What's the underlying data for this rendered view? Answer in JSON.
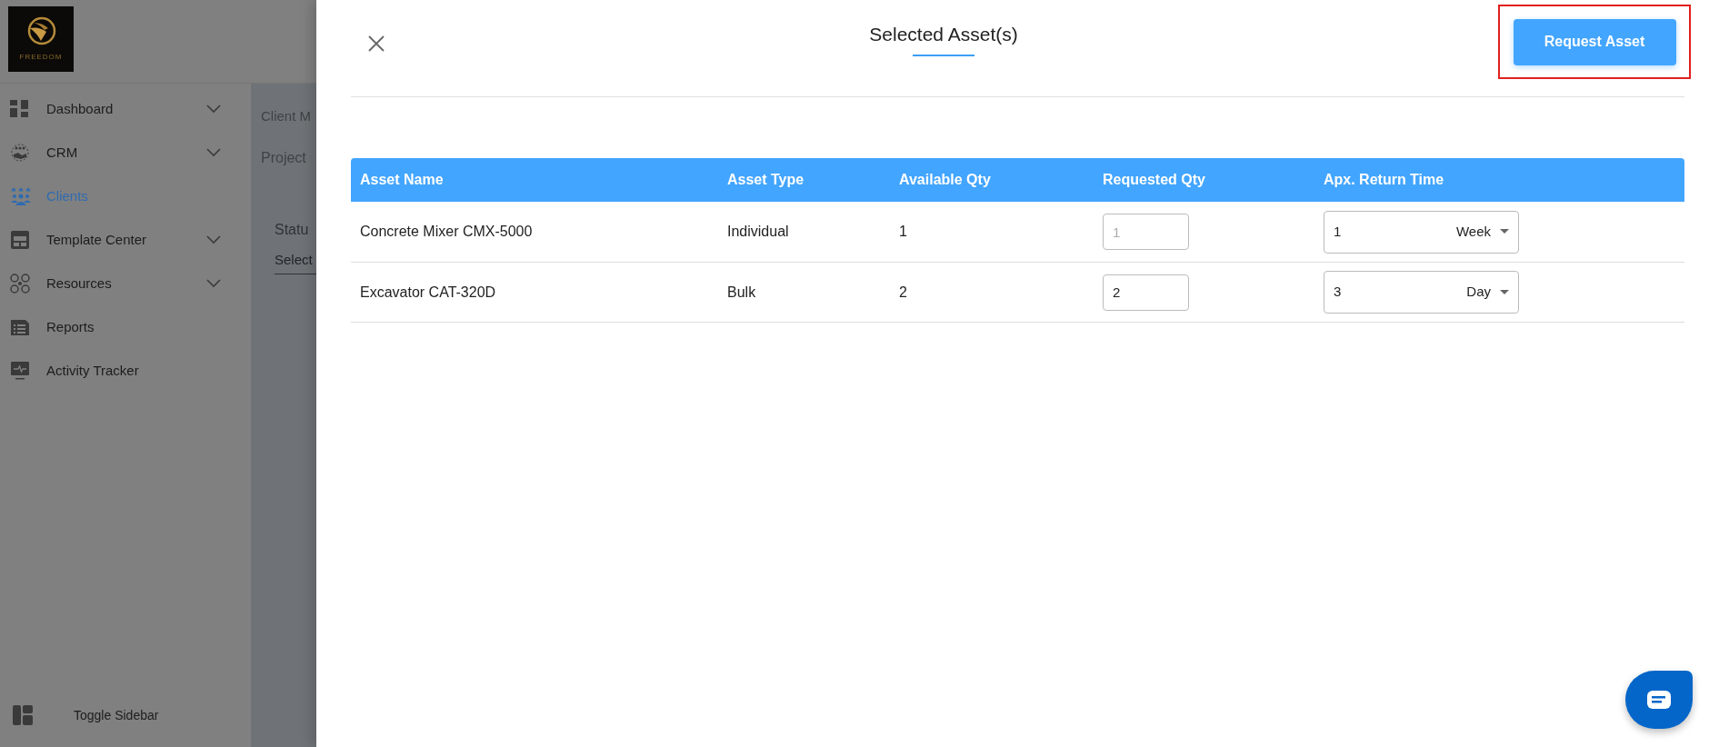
{
  "logo": {
    "text": "FREEDOM"
  },
  "sidebar": {
    "items": [
      {
        "label": "Dashboard",
        "selected": false,
        "expandable": true
      },
      {
        "label": "CRM",
        "selected": false,
        "expandable": true
      },
      {
        "label": "Clients",
        "selected": true,
        "expandable": false
      },
      {
        "label": "Template Center",
        "selected": false,
        "expandable": true
      },
      {
        "label": "Resources",
        "selected": false,
        "expandable": true
      },
      {
        "label": "Reports",
        "selected": false,
        "expandable": false
      },
      {
        "label": "Activity Tracker",
        "selected": false,
        "expandable": false
      }
    ],
    "toggle": "Toggle Sidebar"
  },
  "background": {
    "breadcrumb": "Client M",
    "project": "Project",
    "status_label": "Statu",
    "status_value": "Select"
  },
  "drawer": {
    "title": "Selected Asset(s)",
    "action": "Request Asset",
    "action_highlighted": true,
    "table": {
      "columns": [
        "Asset Name",
        "Asset Type",
        "Available Qty",
        "Requested Qty",
        "Apx. Return Time"
      ],
      "rows": [
        {
          "name": "Concrete Mixer CMX-5000",
          "type": "Individual",
          "available": "1",
          "requested": {
            "placeholder": "1"
          },
          "return_amount": "1",
          "return_unit": "Week"
        },
        {
          "name": "Excavator CAT-320D",
          "type": "Bulk",
          "available": "2",
          "requested": {
            "value": "2"
          },
          "return_amount": "3",
          "return_unit": "Day"
        }
      ]
    }
  }
}
